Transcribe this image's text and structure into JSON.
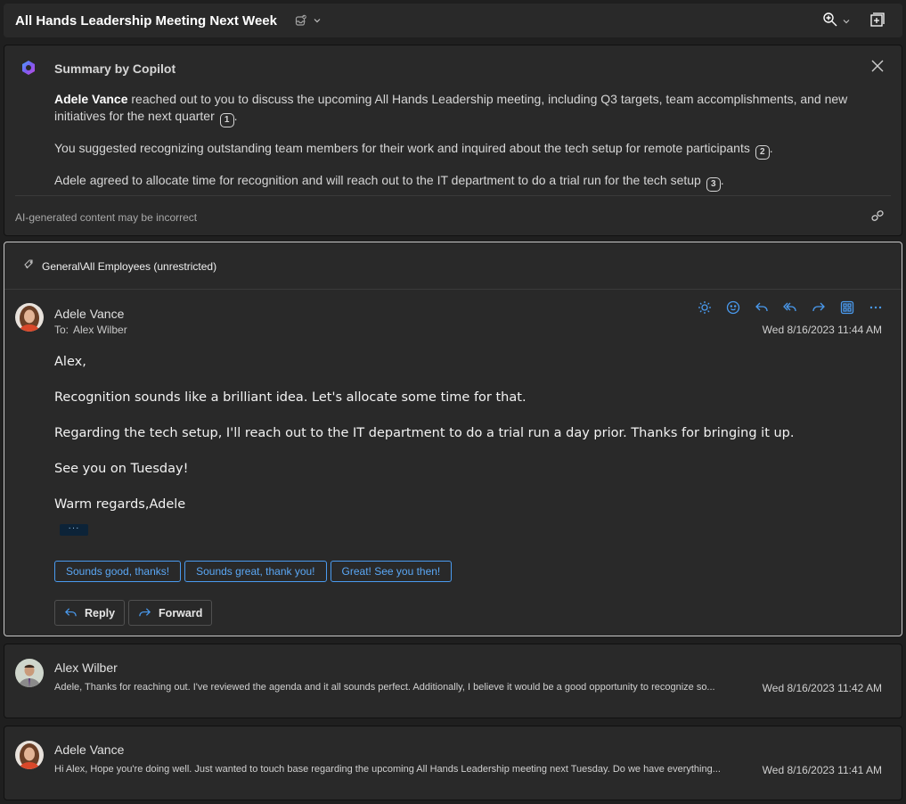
{
  "header": {
    "subject": "All Hands Leadership Meeting Next Week",
    "tag_icon": "tag-check-icon",
    "zoom_icon": "zoom-in-icon",
    "open_new_window_icon": "open-in-new-window-icon"
  },
  "summary": {
    "title": "Summary by Copilot",
    "paragraphs": [
      {
        "bold": "Adele Vance",
        "text": " reached out to you to discuss the upcoming All Hands Leadership meeting, including Q3 targets, team accomplishments, and new initiatives for the next quarter",
        "citation": "1"
      },
      {
        "bold": "",
        "text": "You suggested recognizing outstanding team members for their work and inquired about the tech setup for remote participants",
        "citation": "2"
      },
      {
        "bold": "",
        "text": "Adele agreed to allocate time for recognition and will reach out to the IT department to do a trial run for the tech setup",
        "citation": "3"
      }
    ],
    "disclaimer": "AI-generated content may be incorrect"
  },
  "message": {
    "sensitivity_label": "General\\All Employees (unrestricted)",
    "sender": "Adele Vance",
    "to_label": "To:",
    "to_name": "Alex Wilber",
    "date": "Wed 8/16/2023 11:44 AM",
    "actions": [
      {
        "name": "summarize-icon",
        "title": "Summarize"
      },
      {
        "name": "emoji-react-icon",
        "title": "React"
      },
      {
        "name": "reply-icon",
        "title": "Reply"
      },
      {
        "name": "reply-all-icon",
        "title": "Reply all"
      },
      {
        "name": "forward-icon",
        "title": "Forward"
      },
      {
        "name": "apps-icon",
        "title": "Apps"
      },
      {
        "name": "more-options-icon",
        "title": "More actions"
      }
    ],
    "body": [
      "Alex,",
      "Recognition sounds like a brilliant idea. Let's allocate some time for that.",
      "Regarding the tech setup, I'll reach out to the IT department to do a trial run a day prior. Thanks for bringing it up.",
      "See you on Tuesday!",
      "Warm regards,Adele"
    ],
    "expand_label": "···",
    "quick_replies": [
      "Sounds good, thanks!",
      "Sounds great, thank you!",
      "Great! See you then!"
    ],
    "reply_label": "Reply",
    "forward_label": "Forward"
  },
  "thread": [
    {
      "sender": "Alex Wilber",
      "preview": "Adele, Thanks for reaching out. I've reviewed the agenda and it all sounds perfect. Additionally, I believe it would be a good opportunity to recognize so...",
      "date": "Wed 8/16/2023 11:42 AM"
    },
    {
      "sender": "Adele Vance",
      "preview": "Hi Alex, Hope you're doing well. Just wanted to touch base regarding the upcoming All Hands Leadership meeting next Tuesday. Do we have everything...",
      "date": "Wed 8/16/2023 11:41 AM"
    }
  ],
  "colors": {
    "accent": "#4a9bf0",
    "background": "#1f1f1f",
    "card": "#292929"
  }
}
